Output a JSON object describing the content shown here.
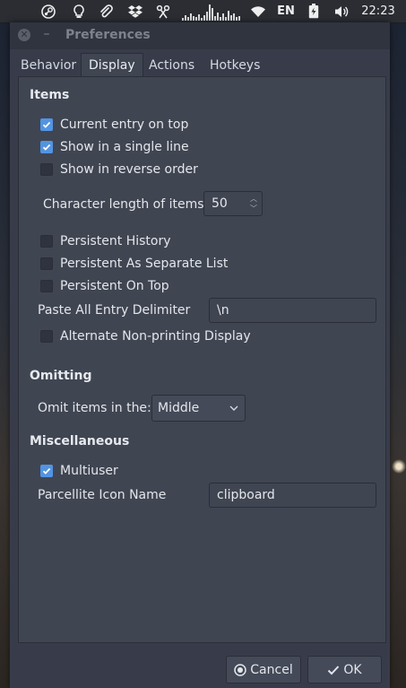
{
  "panel": {
    "icons": [
      "steam-icon",
      "lightbulb-icon",
      "paperclip-icon",
      "dropbox-icon",
      "scissors-icon",
      "system-monitor-graph-icon",
      "wifi-icon",
      "battery-icon",
      "volume-icon"
    ],
    "keyboard_layout": "EN",
    "clock": "22:23"
  },
  "window": {
    "title": "Preferences"
  },
  "tabs": [
    {
      "label": "Behavior",
      "active": false
    },
    {
      "label": "Display",
      "active": true
    },
    {
      "label": "Actions",
      "active": false
    },
    {
      "label": "Hotkeys",
      "active": false
    }
  ],
  "items": {
    "heading": "Items",
    "current_entry_on_top": {
      "label": "Current entry on top",
      "checked": true
    },
    "show_single_line": {
      "label": "Show in a single line",
      "checked": true
    },
    "show_reverse_order": {
      "label": "Show in reverse order",
      "checked": false
    },
    "char_length_label": "Character length of items",
    "char_length_value": "50",
    "persistent_history": {
      "label": "Persistent History",
      "checked": false
    },
    "persistent_separate_list": {
      "label": "Persistent As Separate List",
      "checked": false
    },
    "persistent_on_top": {
      "label": "Persistent On Top",
      "checked": false
    },
    "paste_delimiter_label": "Paste All Entry Delimiter",
    "paste_delimiter_value": "\\n",
    "alternate_nonprinting": {
      "label": "Alternate Non-printing Display",
      "checked": false
    }
  },
  "omitting": {
    "heading": "Omitting",
    "omit_label": "Omit items in the:",
    "omit_selected": "Middle"
  },
  "misc": {
    "heading": "Miscellaneous",
    "multiuser": {
      "label": "Multiuser",
      "checked": true
    },
    "icon_name_label": "Parcellite Icon Name",
    "icon_name_value": "clipboard"
  },
  "buttons": {
    "cancel": "Cancel",
    "ok": "OK"
  },
  "colors": {
    "accent": "#5294e2",
    "window_bg": "#383c4a",
    "page_bg": "#404552",
    "titlebar_bg": "#2f343f"
  }
}
